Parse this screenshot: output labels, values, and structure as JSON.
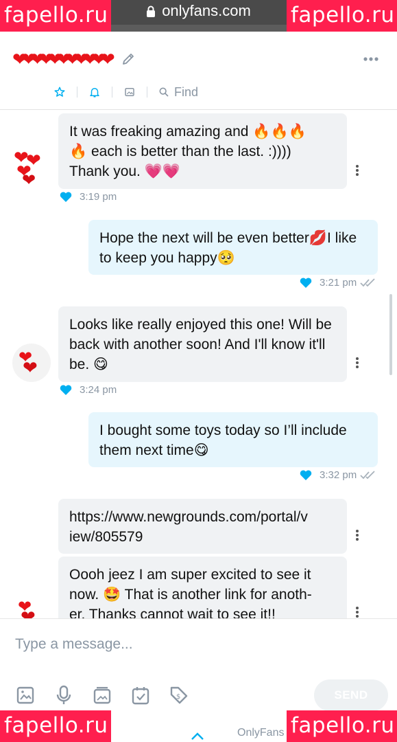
{
  "browser": {
    "url": "onlyfans.com"
  },
  "watermark": {
    "text": "fapello.ru",
    "color": "#ff1f4e"
  },
  "header": {
    "name_decor": "hearts",
    "tabs": [
      {
        "icon": "star-icon"
      },
      {
        "icon": "bell-icon"
      },
      {
        "icon": "image-icon"
      },
      {
        "icon": "search-icon",
        "label": "Find"
      }
    ]
  },
  "messages": [
    {
      "side": "in",
      "text": "It was freaking amazing and 🔥🔥🔥\n🔥 each is better than the last. :)))) \nThank you. 💗💗",
      "time": "3:19 pm"
    },
    {
      "side": "out",
      "text": "Hope the next will be even better💋I like to keep you happy🥺",
      "time": "3:21 pm"
    },
    {
      "side": "in",
      "text": "Looks like really enjoyed this one! Will be back with another soon! And I'll know it'll be. 😋",
      "time": "3:24 pm"
    },
    {
      "side": "out",
      "text": "I bought some toys today so I’ll include them next time😋",
      "time": "3:32 pm"
    },
    {
      "side": "in",
      "text": "https://www.newgrounds.com/portal/v\niew/805579"
    },
    {
      "side": "in",
      "text": "Oooh jeez I am super excited to see it now. 🤩 That is another link for anoth-\ner. Thanks cannot wait to see it!!"
    }
  ],
  "composer": {
    "placeholder": "Type a message...",
    "send_label": "SEND",
    "tools": [
      "image-icon",
      "microphone-icon",
      "media-vault-icon",
      "calendar-icon",
      "price-tag-icon"
    ]
  },
  "footer": {
    "brand": "OnlyFans"
  },
  "colors": {
    "accent": "#00aff0",
    "incoming_bubble": "#f0f2f4",
    "outgoing_bubble": "#e6f6fd",
    "muted": "#8a96a3"
  }
}
